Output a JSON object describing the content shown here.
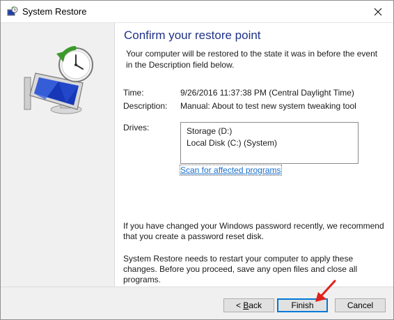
{
  "window": {
    "title": "System Restore",
    "icon": "system-restore-icon",
    "close_icon": "close-icon"
  },
  "main": {
    "heading": "Confirm your restore point",
    "intro": "Your computer will be restored to the state it was in before the event in the Description field below.",
    "time_label": "Time:",
    "time_value": "9/26/2016 11:37:38 PM (Central Daylight Time)",
    "description_label": "Description:",
    "description_value": "Manual: About to test new system tweaking tool",
    "drives_label": "Drives:",
    "drives": [
      "Storage (D:)",
      "Local Disk (C:) (System)"
    ],
    "scan_link": "Scan for affected programs",
    "note_password": "If you have changed your Windows password recently, we recommend that you create a password reset disk.",
    "note_restart": "System Restore needs to restart your computer to apply these changes. Before you proceed, save any open files and close all programs."
  },
  "footer": {
    "back_label": "Back",
    "finish_label": "Finish",
    "cancel_label": "Cancel"
  },
  "colors": {
    "heading": "#1e3287",
    "link": "#1a6fcc",
    "annotation_arrow": "#e0201b",
    "primary_button_border": "#0078d7"
  }
}
